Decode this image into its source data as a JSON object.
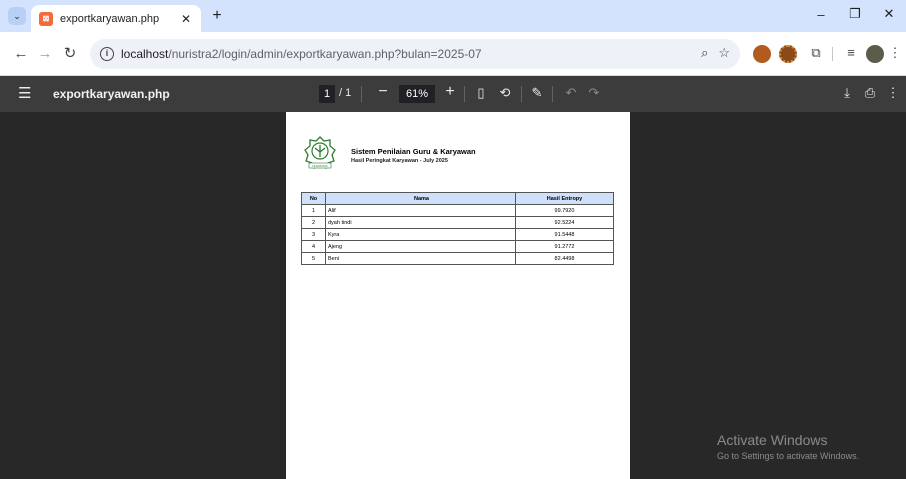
{
  "tab": {
    "title": "exportkaryawan.php",
    "favicon": "xampp-icon"
  },
  "window": {
    "minimize": "–",
    "maximize": "❐",
    "close": "✕"
  },
  "toolbar": {
    "url_host": "localhost",
    "url_path": "/nuristra2/login/admin/exportkaryawan.php?bulan=2025-07"
  },
  "pdf": {
    "filename": "exportkaryawan.php",
    "page_current": "1",
    "page_total": "/ 1",
    "zoom": "61%"
  },
  "document": {
    "title": "Sistem Penilaian Guru & Karyawan",
    "subtitle": "Hasil Peringkat Karyawan - July 2025",
    "logo_text": "NURISTRA",
    "columns": [
      "No",
      "Nama",
      "Hasil Entropy"
    ],
    "rows": [
      {
        "no": "1",
        "nama": "Alif",
        "hasil": "99.7920"
      },
      {
        "no": "2",
        "nama": "dyah tindi",
        "hasil": "92.5224"
      },
      {
        "no": "3",
        "nama": "Kyra",
        "hasil": "91.5448"
      },
      {
        "no": "4",
        "nama": "Ajeng",
        "hasil": "91.2772"
      },
      {
        "no": "5",
        "nama": "Beni",
        "hasil": "82.4498"
      }
    ]
  },
  "watermark": {
    "title": "Activate Windows",
    "subtitle": "Go to Settings to activate Windows."
  },
  "colors": {
    "tabstrip": "#d3e3fd",
    "pdfbar": "#3c3c3c",
    "viewer": "#282828",
    "table_header": "#cfe0fb"
  }
}
